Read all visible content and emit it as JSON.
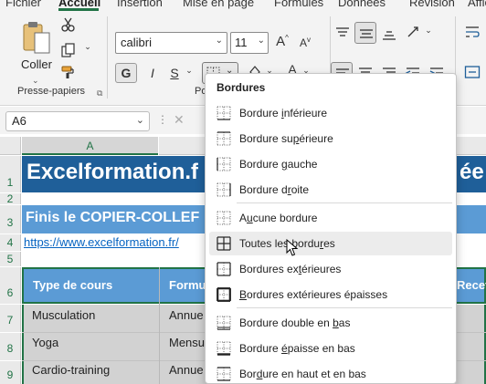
{
  "tabs": {
    "items": [
      "Fichier",
      "Accueil",
      "Insertion",
      "Mise en page",
      "Formules",
      "Données",
      "Révision",
      "Affichage"
    ],
    "active": "Accueil"
  },
  "ribbon": {
    "clipboard": {
      "paste_label": "Coller",
      "group_label": "Presse-papiers"
    },
    "font": {
      "font_name": "calibri",
      "font_size": "11",
      "bold_label": "G",
      "italic_label": "I",
      "underline_label": "S",
      "group_label_partial": "Po"
    }
  },
  "formula_bar": {
    "name_box": "A6",
    "cancel_symbol": "✕"
  },
  "sheet": {
    "column_headers": [
      "A"
    ],
    "row_headers": [
      "1",
      "2",
      "3",
      "4",
      "5",
      "6",
      "7",
      "8",
      "9"
    ],
    "title_text": "Excelformation.f",
    "title_tail": "ée",
    "subtitle_text": "Finis le COPIER-COLLEF",
    "link_text": "https://www.excelformation.fr/",
    "table_header": {
      "col1": "Type de cours",
      "col2": "Formu",
      "col3": "Recet"
    },
    "rows": [
      {
        "type": "Musculation",
        "formula": "Annue"
      },
      {
        "type": "Yoga",
        "formula": "Mensu"
      },
      {
        "type": "Cardio-training",
        "formula": "Annue"
      }
    ]
  },
  "borders_menu": {
    "title": "Bordures",
    "items": [
      {
        "pre": "Bordure ",
        "key": "i",
        "post": "nférieure",
        "icon": "border-bottom-icon"
      },
      {
        "pre": "Bordure su",
        "key": "p",
        "post": "érieure",
        "icon": "border-top-icon"
      },
      {
        "pre": "Bordure ",
        "key": "g",
        "post": "auche",
        "icon": "border-left-icon"
      },
      {
        "pre": "Bordure d",
        "key": "r",
        "post": "oite",
        "icon": "border-right-icon"
      },
      {
        "pre": "A",
        "key": "u",
        "post": "cune bordure",
        "icon": "no-border-icon"
      },
      {
        "pre": "Toutes les bordu",
        "key": "r",
        "post": "es",
        "icon": "all-borders-icon"
      },
      {
        "pre": "Bordures ex",
        "key": "t",
        "post": "érieures",
        "icon": "outside-borders-icon"
      },
      {
        "pre": "",
        "key": "B",
        "post": "ordures extérieures épaisses",
        "icon": "thick-outside-borders-icon"
      },
      {
        "pre": "Bordure double en ",
        "key": "b",
        "post": "as",
        "icon": "double-bottom-border-icon"
      },
      {
        "pre": "Bordure ",
        "key": "é",
        "post": "paisse en bas",
        "icon": "thick-bottom-border-icon"
      },
      {
        "pre": "Bor",
        "key": "d",
        "post": "ure en haut et en bas",
        "icon": "top-bottom-border-icon"
      }
    ],
    "hovered_index": 5
  },
  "colors": {
    "title_band": "#1f5f99",
    "subtitle_band": "#5b9bd5",
    "table_header": "#5b9bd5",
    "accent_green": "#217346",
    "link": "#0563c1"
  }
}
